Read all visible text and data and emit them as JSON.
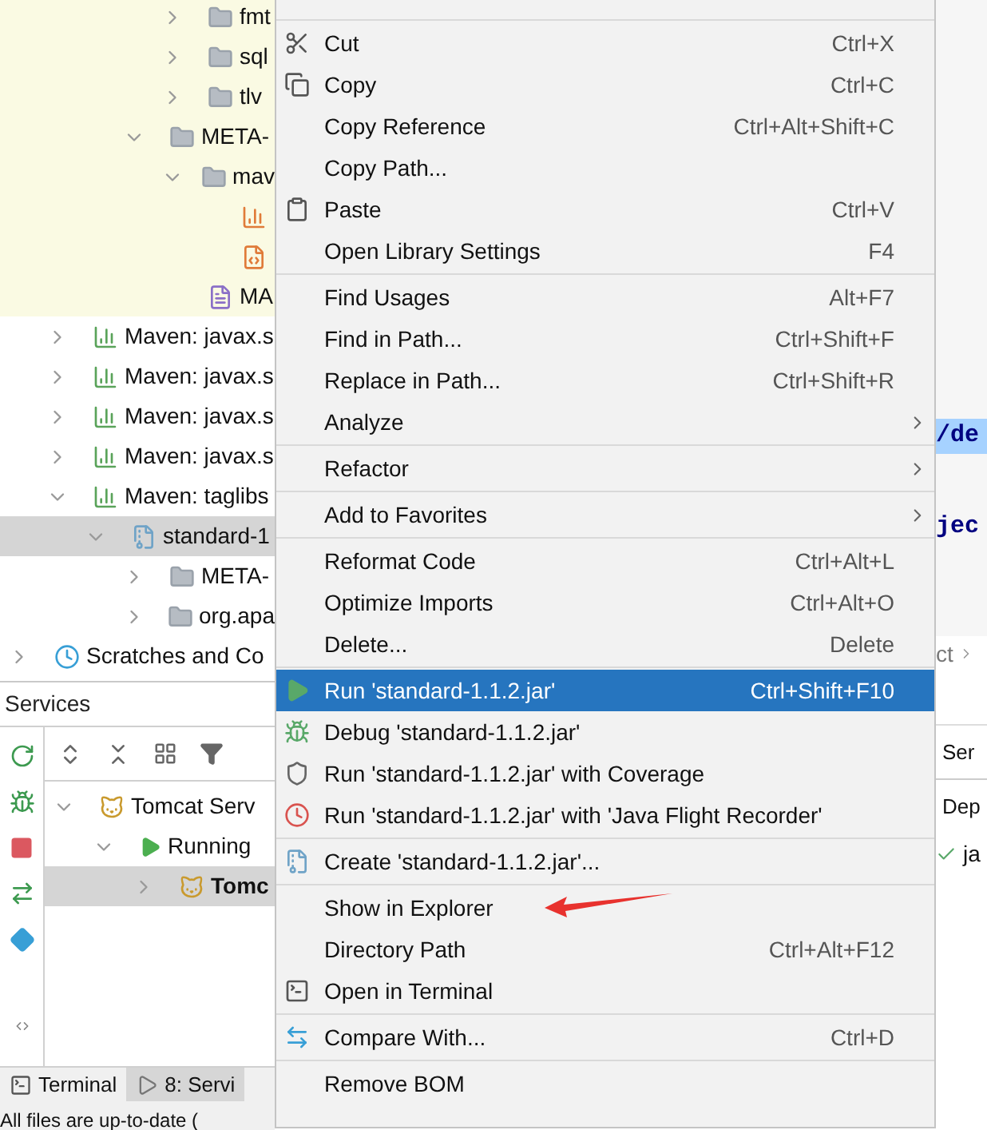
{
  "project_tree": {
    "scrolled_folders": [
      {
        "label": "fmt",
        "kind": "folder",
        "expanded": false,
        "selected": false
      },
      {
        "label": "sql",
        "kind": "folder",
        "expanded": false,
        "selected": false
      },
      {
        "label": "tlv",
        "kind": "folder",
        "expanded": false,
        "selected": false
      }
    ],
    "scrolled_branch": [
      {
        "label": "META-",
        "kind": "folder",
        "expanded": true,
        "selected": false,
        "children": [
          {
            "label": "mav",
            "kind": "folder",
            "expanded": true,
            "selected": false,
            "children": [
              {
                "kind": "chart-file",
                "selected": false
              },
              {
                "kind": "xml-file",
                "selected": false
              }
            ]
          },
          {
            "label": "MA",
            "kind": "manifest",
            "selected": false
          }
        ]
      }
    ],
    "libraries": [
      {
        "label": "Maven: javax.s",
        "kind": "library",
        "expanded": false,
        "selected": false
      },
      {
        "label": "Maven: javax.s",
        "kind": "library",
        "expanded": false,
        "selected": false
      },
      {
        "label": "Maven: javax.s",
        "kind": "library",
        "expanded": false,
        "selected": false
      },
      {
        "label": "Maven: javax.s",
        "kind": "library",
        "expanded": false,
        "selected": false
      },
      {
        "label": "Maven: taglibs",
        "kind": "library",
        "expanded": true,
        "selected": false,
        "children": [
          {
            "label": "standard-1",
            "kind": "jar",
            "expanded": true,
            "selected": true,
            "children": [
              {
                "label": "META-",
                "kind": "folder",
                "expanded": false,
                "selected": false
              },
              {
                "label": "org.apa",
                "kind": "folder",
                "expanded": false,
                "selected": false
              }
            ]
          }
        ]
      }
    ],
    "scratches": [
      {
        "label": "Scratches and Co",
        "kind": "scratches",
        "expanded": false,
        "selected": false
      }
    ]
  },
  "services": {
    "title": "Services",
    "tree": [
      {
        "label": "Tomcat Serv",
        "kind": "tomcat",
        "expanded": true,
        "selected": false,
        "children": [
          {
            "label": "Running",
            "kind": "running",
            "expanded": true,
            "selected": false,
            "children": [
              {
                "label": "Tomc",
                "kind": "tomcat-run",
                "expanded": false,
                "selected": true
              }
            ]
          }
        ]
      }
    ]
  },
  "tool_tabs": [
    {
      "label": "Terminal",
      "kind": "terminal",
      "selected": false
    },
    {
      "label": "8: Servi",
      "kind": "services",
      "selected": true
    }
  ],
  "status_bar": "All files are up-to-date (",
  "context_menu": {
    "groups": [
      [
        {
          "label": "Cut",
          "shortcut": "Ctrl+X",
          "kind": "cut",
          "submenu": false,
          "selected": false
        },
        {
          "label": "Copy",
          "shortcut": "Ctrl+C",
          "kind": "copy",
          "submenu": false,
          "selected": false
        },
        {
          "label": "Copy Reference",
          "shortcut": "Ctrl+Alt+Shift+C",
          "kind": "plain",
          "submenu": false,
          "selected": false
        },
        {
          "label": "Copy Path...",
          "kind": "plain",
          "submenu": false,
          "selected": false
        },
        {
          "label": "Paste",
          "shortcut": "Ctrl+V",
          "kind": "paste",
          "submenu": false,
          "selected": false
        },
        {
          "label": "Open Library Settings",
          "shortcut": "F4",
          "kind": "plain",
          "submenu": false,
          "selected": false
        }
      ],
      [
        {
          "label": "Find Usages",
          "shortcut": "Alt+F7",
          "kind": "plain",
          "submenu": false,
          "selected": false
        },
        {
          "label": "Find in Path...",
          "shortcut": "Ctrl+Shift+F",
          "kind": "plain",
          "submenu": false,
          "selected": false
        },
        {
          "label": "Replace in Path...",
          "shortcut": "Ctrl+Shift+R",
          "kind": "plain",
          "submenu": false,
          "selected": false
        },
        {
          "label": "Analyze",
          "kind": "plain",
          "submenu": true,
          "selected": false
        }
      ],
      [
        {
          "label": "Refactor",
          "kind": "plain",
          "submenu": true,
          "selected": false
        }
      ],
      [
        {
          "label": "Add to Favorites",
          "kind": "plain",
          "submenu": true,
          "selected": false
        }
      ],
      [
        {
          "label": "Reformat Code",
          "shortcut": "Ctrl+Alt+L",
          "kind": "plain",
          "submenu": false,
          "selected": false
        },
        {
          "label": "Optimize Imports",
          "shortcut": "Ctrl+Alt+O",
          "kind": "plain",
          "submenu": false,
          "selected": false
        },
        {
          "label": "Delete...",
          "shortcut": "Delete",
          "kind": "plain",
          "submenu": false,
          "selected": false
        }
      ],
      [
        {
          "label": "Run 'standard-1.1.2.jar'",
          "shortcut": "Ctrl+Shift+F10",
          "kind": "run",
          "submenu": false,
          "selected": true
        },
        {
          "label": "Debug 'standard-1.1.2.jar'",
          "kind": "debug",
          "submenu": false,
          "selected": false
        },
        {
          "label": "Run 'standard-1.1.2.jar' with Coverage",
          "kind": "coverage",
          "submenu": false,
          "selected": false
        },
        {
          "label": "Run 'standard-1.1.2.jar' with 'Java Flight Recorder'",
          "kind": "profiler",
          "submenu": false,
          "selected": false
        }
      ],
      [
        {
          "label": "Create 'standard-1.1.2.jar'...",
          "kind": "archive",
          "submenu": false,
          "selected": false
        }
      ],
      [
        {
          "label": "Show in Explorer",
          "kind": "plain",
          "submenu": false,
          "selected": false,
          "annotated": true
        },
        {
          "label": "Directory Path",
          "shortcut": "Ctrl+Alt+F12",
          "kind": "plain",
          "submenu": false,
          "selected": false
        },
        {
          "label": "Open in Terminal",
          "kind": "terminal",
          "submenu": false,
          "selected": false
        }
      ],
      [
        {
          "label": "Compare With...",
          "shortcut": "Ctrl+D",
          "kind": "compare",
          "submenu": false,
          "selected": false
        }
      ],
      [
        {
          "label": "Remove BOM",
          "kind": "plain",
          "submenu": false,
          "selected": false
        }
      ]
    ]
  },
  "editor_fragments": {
    "code_1": "/de",
    "code_2": "jec",
    "breadcrumb": "ct",
    "column_1": "Ser",
    "column_2": "Dep",
    "row_1": "ja"
  }
}
